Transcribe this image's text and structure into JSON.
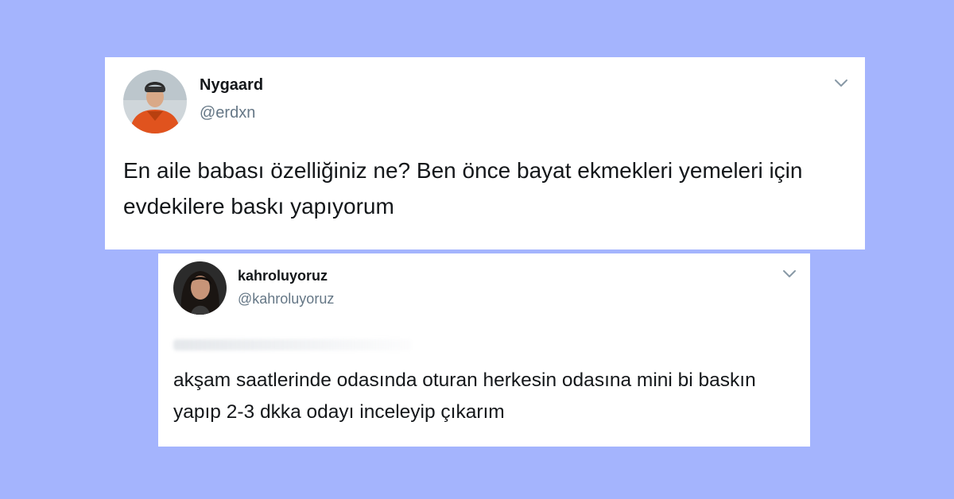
{
  "tweets": [
    {
      "name": "Nygaard",
      "handle": "@erdxn",
      "text": "En aile babası özelliğiniz ne? Ben önce bayat ekmekleri yemeleri için evdekilere baskı yapıyorum",
      "menu_icon": "chevron-down-icon"
    },
    {
      "name": "kahroluyoruz",
      "handle": "@kahroluyoruz",
      "text": "akşam saatlerinde odasında oturan herkesin odasına mini bi baskın yapıp 2-3 dkka odayı inceleyip çıkarım",
      "menu_icon": "chevron-down-icon"
    }
  ],
  "colors": {
    "background": "#a4b4fd",
    "card": "#ffffff",
    "name": "#14171a",
    "handle": "#657786",
    "chevron": "#8899a6"
  }
}
